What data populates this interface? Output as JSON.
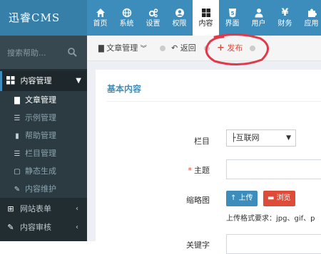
{
  "app": {
    "logo_text": "迅睿CMS"
  },
  "nav": [
    {
      "label": "首页",
      "icon": "home-icon"
    },
    {
      "label": "系统",
      "icon": "globe-icon"
    },
    {
      "label": "设置",
      "icon": "cogs-icon"
    },
    {
      "label": "权限",
      "icon": "user-circle-icon"
    },
    {
      "label": "内容",
      "icon": "th-large-icon",
      "active": true
    },
    {
      "label": "界面",
      "icon": "html5-icon"
    },
    {
      "label": "用户",
      "icon": "user-icon"
    },
    {
      "label": "财务",
      "icon": "yen-icon"
    },
    {
      "label": "应用",
      "icon": "puzzle-icon"
    }
  ],
  "sidebar": {
    "search_placeholder": "搜索帮助...",
    "menu_head": "内容管理",
    "sub_items": [
      {
        "label": "文章管理",
        "icon": "file-icon",
        "active": true
      },
      {
        "label": "示例管理",
        "icon": "list-icon"
      },
      {
        "label": "帮助管理",
        "icon": "book-icon"
      },
      {
        "label": "栏目管理",
        "icon": "list-icon"
      },
      {
        "label": "静态生成",
        "icon": "file-code-icon"
      },
      {
        "label": "内容维护",
        "icon": "wrench-icon"
      }
    ],
    "groups": [
      {
        "label": "网站表单",
        "icon": "table-icon"
      },
      {
        "label": "内容审核",
        "icon": "edit-icon"
      }
    ]
  },
  "tabs": {
    "article_manage": "文章管理",
    "back": "返回",
    "publish": "发布"
  },
  "form": {
    "section_title": "基本内容",
    "category_label": "栏目",
    "category_value": "├互联网",
    "subject_label": "主题",
    "subject_required": "*",
    "thumbnail_label": "缩略图",
    "upload_button": "上传",
    "browse_button": "浏览",
    "upload_hint": "上传格式要求：jpg、gif、p",
    "keywords_label": "关键字"
  },
  "colors": {
    "header_bg": "#3c8dbc",
    "sidebar_bg": "#222d32",
    "accent_red": "#dd4b39",
    "accent_blue": "#3c8dbc"
  }
}
